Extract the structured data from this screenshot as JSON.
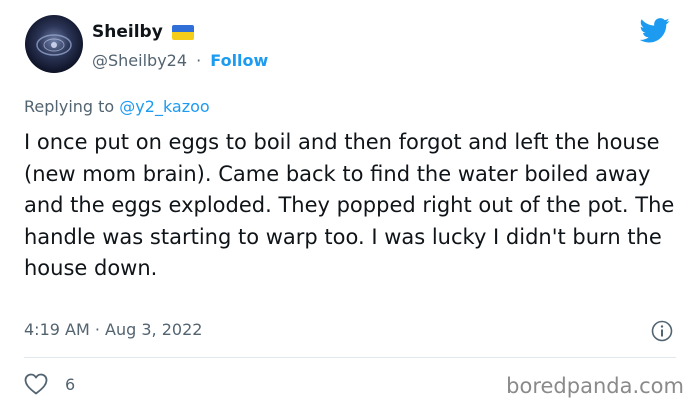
{
  "author": {
    "display_name": "Sheilby",
    "handle": "@Sheilby24",
    "separator": "·",
    "follow_label": "Follow"
  },
  "reply": {
    "prefix": "Replying to ",
    "to": "@y2_kazoo"
  },
  "tweet": {
    "text": "I once put on eggs to boil and then forgot and left the house (new mom brain). Came back to find the water boiled away and the eggs exploded. They popped right out of the pot. The handle was starting to warp too. I was lucky I didn't burn the house down.",
    "timestamp": "4:19 AM · Aug 3, 2022",
    "like_count": "6"
  },
  "watermark": "boredpanda.com",
  "colors": {
    "accent": "#1d9bf0",
    "muted": "#536471",
    "flag_blue": "#2f6fd6",
    "flag_yellow": "#f4cd1b"
  },
  "icons": {
    "brand": "twitter-bird-icon",
    "info": "info-icon",
    "like": "heart-icon",
    "flag": "ukraine-flag-icon"
  }
}
